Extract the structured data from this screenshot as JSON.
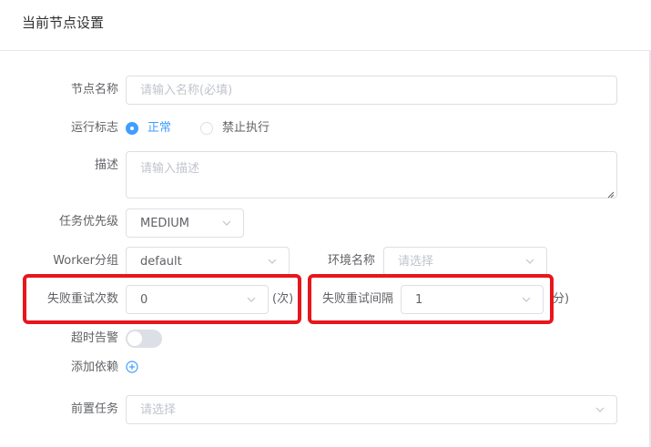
{
  "header": {
    "title": "当前节点设置"
  },
  "form": {
    "node_name": {
      "label": "节点名称",
      "placeholder": "请输入名称(必填)"
    },
    "run_flag": {
      "label": "运行标志",
      "options": [
        "正常",
        "禁止执行"
      ],
      "selected": "正常"
    },
    "description": {
      "label": "描述",
      "placeholder": "请输入描述"
    },
    "priority": {
      "label": "任务优先级",
      "value": "MEDIUM"
    },
    "worker_group": {
      "label": "Worker分组",
      "value": "default"
    },
    "env_name": {
      "label": "环境名称",
      "placeholder": "请选择"
    },
    "fail_retry_times": {
      "label": "失败重试次数",
      "value": "0",
      "unit": "(次)"
    },
    "fail_retry_interval": {
      "label": "失败重试间隔",
      "value": "1",
      "unit": "分)"
    },
    "timeout_alarm": {
      "label": "超时告警",
      "enabled": false
    },
    "add_dependency": {
      "label": "添加依赖"
    },
    "pre_task": {
      "label": "前置任务",
      "placeholder": "请选择"
    }
  },
  "colors": {
    "primary": "#409eff",
    "highlight_box": "#e8161c",
    "border": "#dcdfe6",
    "placeholder": "#c0c4cc"
  }
}
